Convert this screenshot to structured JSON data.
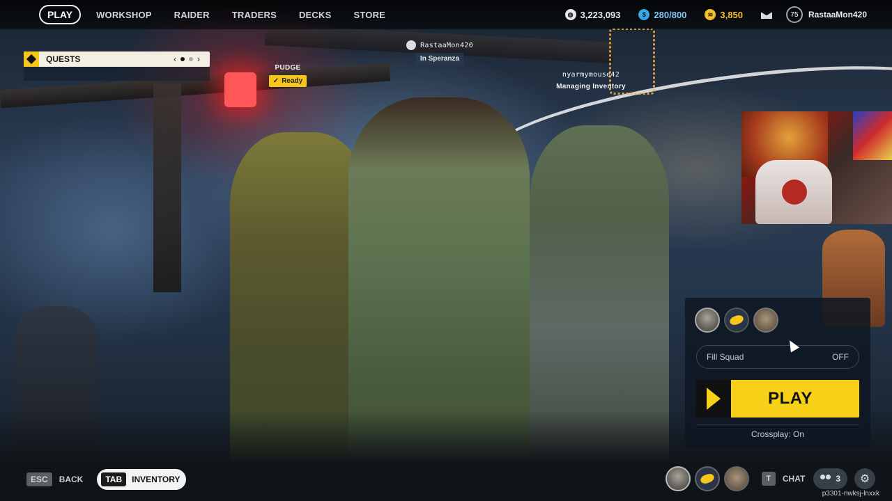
{
  "topbar": {
    "nav": {
      "play": "PLAY",
      "items": [
        "WORKSHOP",
        "RAIDER",
        "TRADERS",
        "DECKS",
        "STORE"
      ]
    },
    "stats": {
      "coins": "3,223,093",
      "raider_tokens": "280/800",
      "cred": "3,850"
    },
    "icons": {
      "coins": "coins-icon",
      "tokens": "raider-token-icon",
      "cred": "cred-icon",
      "mail": "mail-icon"
    },
    "player": {
      "level": "75",
      "name": "RastaaMon420"
    }
  },
  "quests": {
    "title": "QUESTS",
    "prev": "‹",
    "next": "›"
  },
  "players": {
    "p1": {
      "name": "PUDGE",
      "status": "Ready",
      "check": "✓"
    },
    "p2": {
      "name": "RastaaMon420",
      "status": "In Speranza"
    },
    "p3": {
      "name": "nyarmymouse42",
      "status": "Managing Inventory"
    }
  },
  "squad": {
    "fill_label": "Fill Squad",
    "fill_value": "OFF",
    "play_label": "PLAY",
    "crossplay": "Crossplay: On"
  },
  "bottom": {
    "esc_key": "ESC",
    "back_label": "BACK",
    "tab_key": "TAB",
    "inventory_label": "INVENTORY",
    "chat_key": "T",
    "chat_label": "CHAT",
    "friends_count": "3",
    "gear": "⚙"
  },
  "session_code": "p3301-nwksj-lnxxk",
  "colors": {
    "accent_yellow": "#f7d117",
    "token_blue": "#36a7e4",
    "cred_gold": "#f3c12a",
    "panel_bg": "#0e1622"
  }
}
